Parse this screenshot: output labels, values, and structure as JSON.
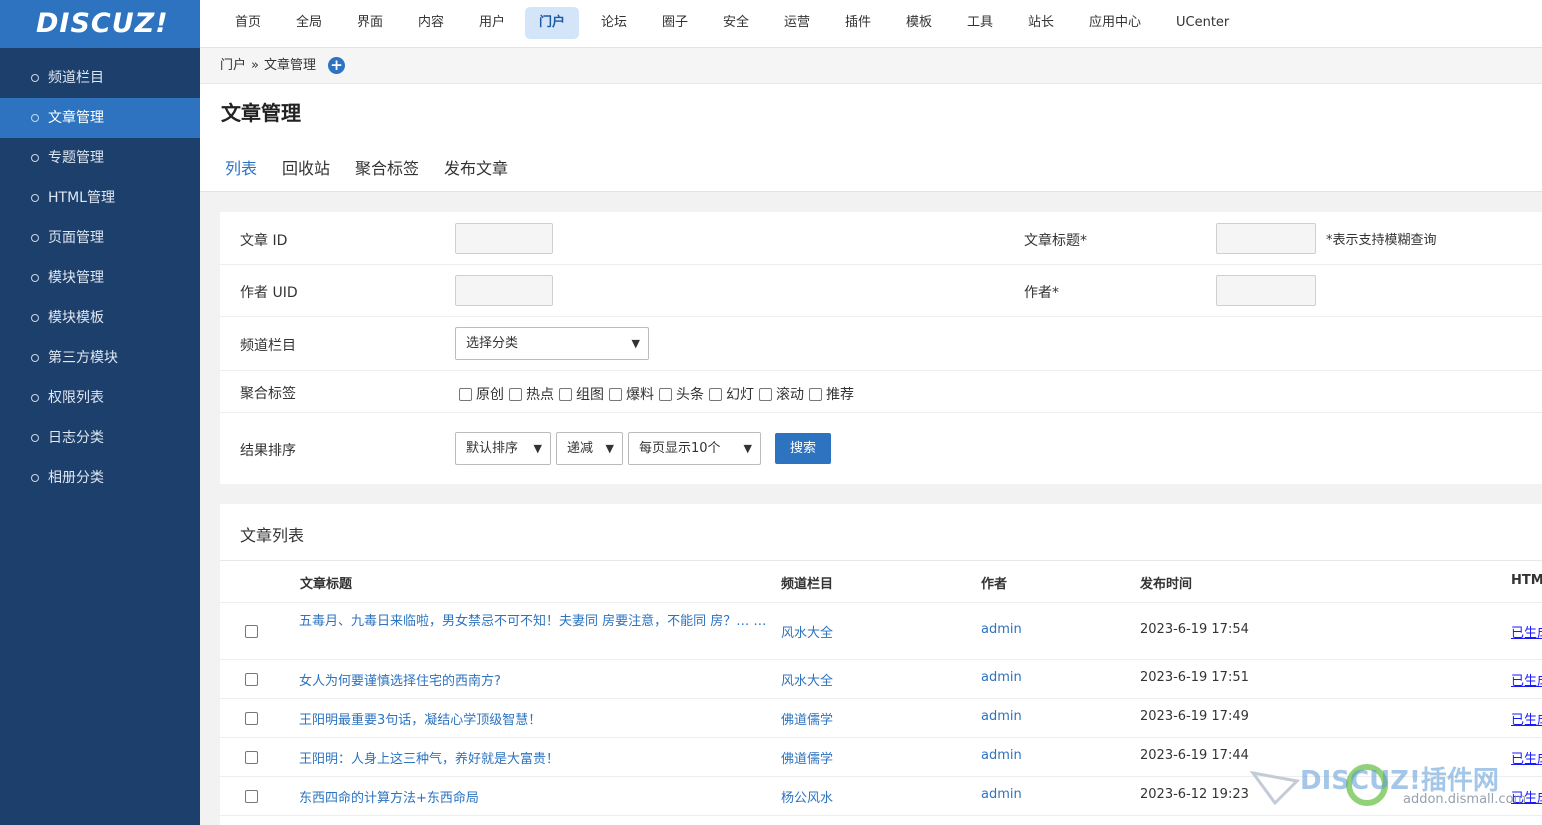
{
  "brand": {
    "logo_text": "DISCUZ!"
  },
  "sidebar": {
    "items": [
      {
        "label": "频道栏目"
      },
      {
        "label": "文章管理"
      },
      {
        "label": "专题管理"
      },
      {
        "label": "HTML管理"
      },
      {
        "label": "页面管理"
      },
      {
        "label": "模块管理"
      },
      {
        "label": "模块模板"
      },
      {
        "label": "第三方模块"
      },
      {
        "label": "权限列表"
      },
      {
        "label": "日志分类"
      },
      {
        "label": "相册分类"
      }
    ],
    "active_index": 1
  },
  "topnav": {
    "items": [
      {
        "label": "首页"
      },
      {
        "label": "全局"
      },
      {
        "label": "界面"
      },
      {
        "label": "内容"
      },
      {
        "label": "用户"
      },
      {
        "label": "门户"
      },
      {
        "label": "论坛"
      },
      {
        "label": "圈子"
      },
      {
        "label": "安全"
      },
      {
        "label": "运营"
      },
      {
        "label": "插件"
      },
      {
        "label": "模板"
      },
      {
        "label": "工具"
      },
      {
        "label": "站长"
      },
      {
        "label": "应用中心"
      },
      {
        "label": "UCenter"
      }
    ],
    "active_index": 5
  },
  "breadcrumb": {
    "root": "门户",
    "sep": "»",
    "current": "文章管理",
    "add_icon": "+"
  },
  "page": {
    "title": "文章管理"
  },
  "tabs": [
    {
      "label": "列表"
    },
    {
      "label": "回收站"
    },
    {
      "label": "聚合标签"
    },
    {
      "label": "发布文章"
    }
  ],
  "search": {
    "article_id_label": "文章 ID",
    "article_title_label": "文章标题*",
    "fuzzy_note": "*表示支持模糊查询",
    "author_uid_label": "作者 UID",
    "author_label": "作者*",
    "channel_label": "频道栏目",
    "channel_select": "选择分类",
    "tags_label": "聚合标签",
    "tags": [
      "原创",
      "热点",
      "组图",
      "爆料",
      "头条",
      "幻灯",
      "滚动",
      "推荐"
    ],
    "sort_label": "结果排序",
    "sort_select": "默认排序",
    "order_select": "递减",
    "perpage_select": "每页显示10个",
    "search_button": "搜索"
  },
  "list": {
    "title": "文章列表",
    "columns": {
      "title": "文章标题",
      "channel": "频道栏目",
      "author": "作者",
      "time": "发布时间",
      "html": "HTM"
    },
    "rows": [
      {
        "title": "五毒月、九毒日来临啦，男女禁忌不可不知！夫妻同 房要注意，不能同 房？… …",
        "channel": "风水大全",
        "author": "admin",
        "time": "2023-6-19 17:54",
        "html": "已生成"
      },
      {
        "title": "女人为何要谨慎选择住宅的西南方?",
        "channel": "风水大全",
        "author": "admin",
        "time": "2023-6-19 17:51",
        "html": "已生成"
      },
      {
        "title": "王阳明最重要3句话，凝结心学顶级智慧！",
        "channel": "佛道儒学",
        "author": "admin",
        "time": "2023-6-19 17:49",
        "html": "已生成"
      },
      {
        "title": "王阳明：人身上这三种气，养好就是大富贵！",
        "channel": "佛道儒学",
        "author": "admin",
        "time": "2023-6-19 17:44",
        "html": "已生成"
      },
      {
        "title": "东西四命的计算方法+东西命局",
        "channel": "杨公风水",
        "author": "admin",
        "time": "2023-6-12 19:23",
        "html": "已生成"
      }
    ]
  },
  "watermark": {
    "line1": "DISCUZ!插件网",
    "line2": "addon.dismall.com"
  },
  "colors": {
    "sidebar_bg": "#1d3f6b",
    "accent": "#2d73c0"
  }
}
